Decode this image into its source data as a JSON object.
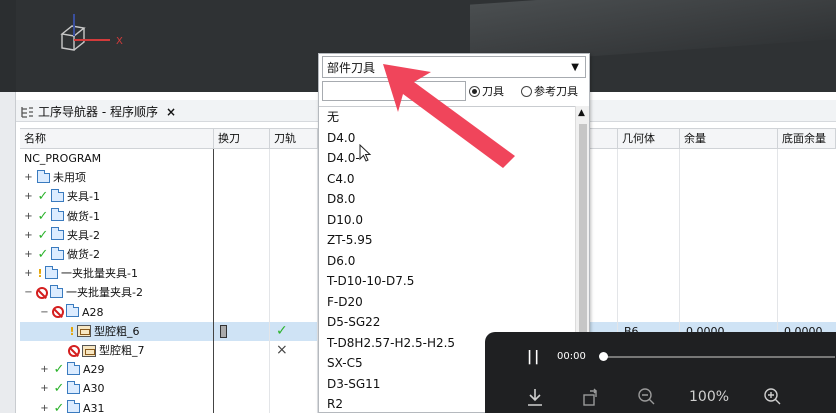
{
  "axis_label": "X",
  "navigator": {
    "tab_title": "工序导航器 - 程序顺序",
    "close_glyph": "×",
    "columns": [
      "名称",
      "换刀",
      "刀轨",
      "几何体",
      "余量",
      "底面余量"
    ],
    "rows": [
      {
        "label": "NC_PROGRAM",
        "level": 0,
        "status": "none",
        "exp": "",
        "type": "text"
      },
      {
        "label": "未用项",
        "level": 0,
        "status": "none",
        "exp": "+",
        "type": "folder"
      },
      {
        "label": "夹具-1",
        "level": 0,
        "status": "check",
        "exp": "+",
        "type": "folder"
      },
      {
        "label": "做货-1",
        "level": 0,
        "status": "check",
        "exp": "+",
        "type": "folder"
      },
      {
        "label": "夹具-2",
        "level": 0,
        "status": "check",
        "exp": "+",
        "type": "folder"
      },
      {
        "label": "做货-2",
        "level": 0,
        "status": "check",
        "exp": "+",
        "type": "folder"
      },
      {
        "label": "一夹批量夹具-1",
        "level": 0,
        "status": "warn",
        "exp": "+",
        "type": "folder"
      },
      {
        "label": "一夹批量夹具-2",
        "level": 0,
        "status": "ban",
        "exp": "−",
        "type": "folder"
      },
      {
        "label": "A28",
        "level": 1,
        "status": "ban",
        "exp": "−",
        "type": "folder"
      },
      {
        "label": "型腔粗_6",
        "level": 2,
        "status": "warn",
        "exp": "",
        "type": "op",
        "selected": true,
        "toolchange": "tool-badge",
        "path": "✓",
        "geometry": "B6",
        "stock": "0.0000",
        "floor_stock": "0.0000"
      },
      {
        "label": "型腔粗_7",
        "level": 2,
        "status": "ban",
        "exp": "",
        "type": "op",
        "path": "×"
      },
      {
        "label": "A29",
        "level": 1,
        "status": "check",
        "exp": "+",
        "type": "folder"
      },
      {
        "label": "A30",
        "level": 1,
        "status": "check",
        "exp": "+",
        "type": "folder"
      },
      {
        "label": "A31",
        "level": 1,
        "status": "check",
        "exp": "+",
        "type": "folder"
      }
    ]
  },
  "tool_panel": {
    "selected": "部件刀具",
    "filter_value": "",
    "radio_tool": "刀具",
    "radio_ref": "参考刀具",
    "radio_selected": "tool",
    "items": [
      "无",
      "D4.0",
      "D4.0-",
      "C4.0",
      "D8.0",
      "D10.0",
      "ZT-5.95",
      "D6.0",
      "T-D10-10-D7.5",
      "F-D20",
      "D5-SG22",
      "T-D8H2.57-H2.5-H2.5",
      "SX-C5",
      "D3-SG11",
      "R2"
    ]
  },
  "video": {
    "time": "00:00",
    "zoom": "100%",
    "progress": 0
  },
  "colors": {
    "accent_arrow": "#f0455b",
    "check": "#2bb32b",
    "warn": "#e6a400",
    "ban": "#d41f1f",
    "selected_row": "#cfe3f5"
  },
  "icons": [
    "folder-icon",
    "operation-icon",
    "check-icon",
    "warning-icon",
    "no-entry-icon",
    "pause-icon",
    "download-icon",
    "rotate-icon",
    "zoom-out-icon",
    "zoom-in-icon"
  ]
}
